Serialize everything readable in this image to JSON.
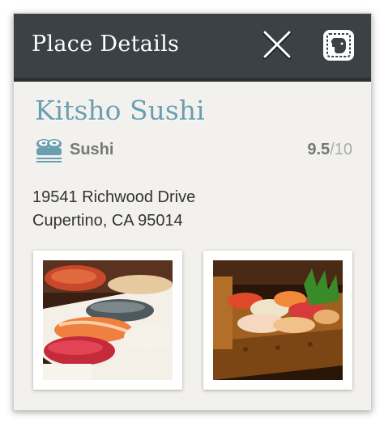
{
  "header": {
    "title": "Place Details",
    "close_icon": "close-icon",
    "evernote_icon": "evernote-elephant-icon"
  },
  "place": {
    "name": "Kitsho Sushi",
    "category": "Sushi",
    "category_icon": "sushi-icon",
    "rating_score": "9.5",
    "rating_max": "/10",
    "address_line1": "19541 Richwood Drive",
    "address_line2": "Cupertino, CA 95014"
  },
  "photos": [
    {
      "subject": "sushi-nigiri-plate"
    },
    {
      "subject": "sushi-boat"
    }
  ],
  "colors": {
    "header_bg": "#3b4246",
    "place_name": "#6a9fb0",
    "card_bg": "#f2f1ee"
  }
}
